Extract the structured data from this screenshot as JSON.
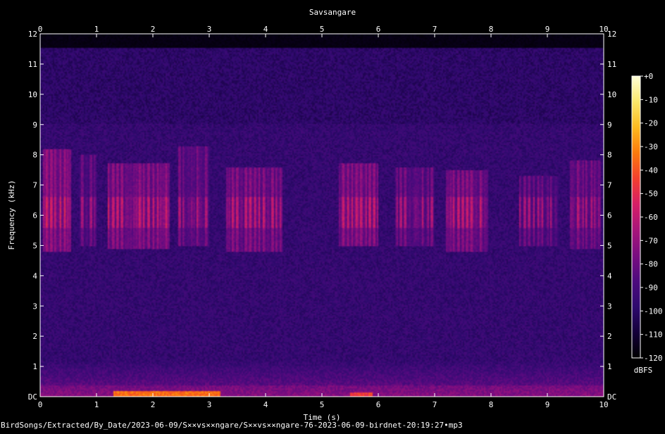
{
  "chart_data": {
    "type": "heatmap",
    "title": "Savsangare",
    "xlabel": "Time (s)",
    "ylabel": "Frequency (kHz)",
    "xlim": [
      0,
      10
    ],
    "ylim": [
      0,
      12
    ],
    "x_ticks": [
      "0",
      "1",
      "2",
      "3",
      "4",
      "5",
      "6",
      "7",
      "8",
      "9",
      "10"
    ],
    "y_ticks": [
      "DC",
      "1",
      "2",
      "3",
      "4",
      "5",
      "6",
      "7",
      "8",
      "9",
      "10",
      "11",
      "12"
    ],
    "colorbar": {
      "label": "dBFS",
      "range": [
        -120,
        0
      ],
      "ticks": [
        "+0",
        "-10",
        "-20",
        "-30",
        "-40",
        "-50",
        "-60",
        "-70",
        "-80",
        "-90",
        "-100",
        "-110",
        "-120"
      ],
      "colormap": [
        "#000000",
        "#14003a",
        "#2e0a6e",
        "#4d0a7e",
        "#7a0d80",
        "#a8157a",
        "#d61e66",
        "#f2402e",
        "#fb7a0c",
        "#fdba1f",
        "#fbe86b",
        "#ffffd8"
      ]
    },
    "footer": "BirdSongs/Extracted/By_Date/2023-06-09/S××vs××ngare/S××vs××ngare-76-2023-06-09-birdnet-20:19:27•mp3",
    "bursts": [
      {
        "t0": 0.05,
        "t1": 0.55,
        "f0": 4.8,
        "f1": 8.2,
        "db": -52
      },
      {
        "t0": 0.7,
        "t1": 1.0,
        "f0": 5.0,
        "f1": 8.0,
        "db": -62
      },
      {
        "t0": 1.2,
        "t1": 2.3,
        "f0": 4.9,
        "f1": 7.7,
        "db": -55
      },
      {
        "t0": 2.45,
        "t1": 3.0,
        "f0": 5.0,
        "f1": 8.3,
        "db": -60
      },
      {
        "t0": 3.3,
        "t1": 4.3,
        "f0": 4.8,
        "f1": 7.6,
        "db": -56
      },
      {
        "t0": 5.3,
        "t1": 6.0,
        "f0": 5.0,
        "f1": 7.7,
        "db": -55
      },
      {
        "t0": 6.3,
        "t1": 7.0,
        "f0": 5.0,
        "f1": 7.6,
        "db": -60
      },
      {
        "t0": 7.2,
        "t1": 7.95,
        "f0": 4.8,
        "f1": 7.5,
        "db": -56
      },
      {
        "t0": 8.5,
        "t1": 9.2,
        "f0": 5.0,
        "f1": 7.3,
        "db": -62
      },
      {
        "t0": 9.4,
        "t1": 9.95,
        "f0": 4.9,
        "f1": 7.8,
        "db": -58
      }
    ],
    "low_band": [
      {
        "t0": 1.3,
        "t1": 3.2,
        "f0": 0.0,
        "f1": 0.18,
        "db": -35
      },
      {
        "t0": 5.5,
        "t1": 5.9,
        "f0": 0.0,
        "f1": 0.12,
        "db": -45
      }
    ]
  }
}
